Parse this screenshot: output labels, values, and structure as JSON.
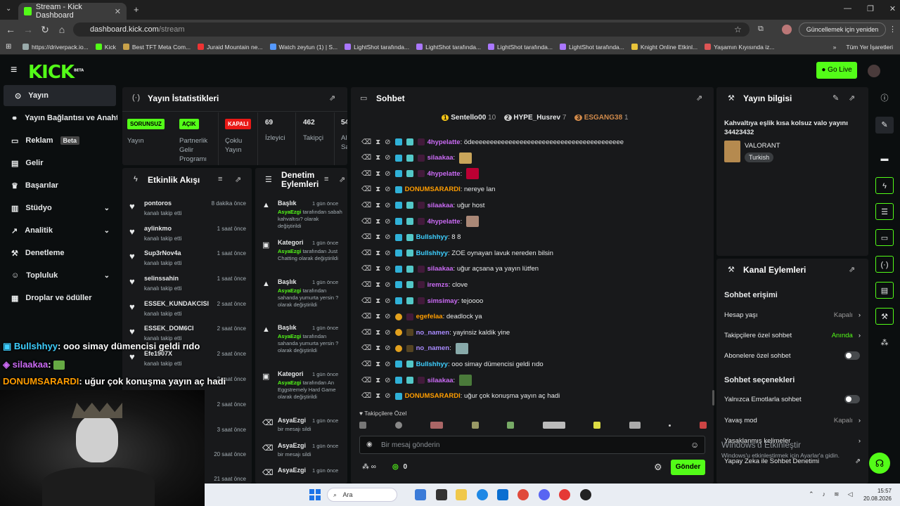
{
  "browser": {
    "tab_title": "Stream - Kick Dashboard",
    "url_host": "dashboard.kick.com",
    "url_path": "/stream",
    "update_button": "Güncellemek için yeniden başlat",
    "bookmarks": [
      "https://driverpack.io...",
      "Kick",
      "Best TFT Meta Com...",
      "Juraid Mountain ne...",
      "Watch zeytun (1) | S...",
      "LightShot tarafında...",
      "LightShot tarafında...",
      "LightShot tarafında...",
      "LightShot tarafında...",
      "Knight Online Etkinl...",
      "Yaşamın Kıyısında iz..."
    ],
    "bookmarks_all": "Tüm Yer İşaretleri"
  },
  "header": {
    "logo": "KICK",
    "logo_sup": "BETA",
    "go_live": "Go Live"
  },
  "sidebar": {
    "items": [
      {
        "label": "Yayın"
      },
      {
        "label": "Yayın Bağlantısı ve Anahtarı"
      },
      {
        "label": "Reklam",
        "badge": "Beta"
      },
      {
        "label": "Gelir"
      },
      {
        "label": "Başarılar"
      },
      {
        "label": "Stüdyo"
      },
      {
        "label": "Analitik"
      },
      {
        "label": "Denetleme"
      },
      {
        "label": "Topluluk"
      },
      {
        "label": "Droplar ve ödüller"
      }
    ]
  },
  "stats": {
    "title": "Yayın İstatistikleri",
    "cols": [
      {
        "tag": "SORUNSUZ",
        "label": "Yayın"
      },
      {
        "tag": "AÇIK",
        "label": "Partnerlik Gelir Programı"
      },
      {
        "tag": "KAPALI",
        "label": "Çoklu Yayın"
      },
      {
        "value": "69",
        "label": "İzleyici"
      },
      {
        "value": "462",
        "label": "Takipçi"
      },
      {
        "value": "54",
        "label": "Al Sa"
      }
    ]
  },
  "activity": {
    "title": "Etkinlik Akışı",
    "items": [
      {
        "name": "pontoros",
        "action": "kanalı takip etti",
        "time": "8 dakika önce"
      },
      {
        "name": "aylinkmo",
        "action": "kanalı takip etti",
        "time": "1 saat önce"
      },
      {
        "name": "Sup3rNov4a",
        "action": "kanalı takip etti",
        "time": "1 saat önce"
      },
      {
        "name": "selinssahin",
        "action": "kanalı takip etti",
        "time": "1 saat önce"
      },
      {
        "name": "ESSEK_KUNDAKCISI",
        "action": "kanalı takip etti",
        "time": "2 saat önce"
      },
      {
        "name": "ESSEK_DOM6CI",
        "action": "kanalı takip etti",
        "time": "2 saat önce"
      },
      {
        "name": "Efe1907X",
        "action": "kanalı takip etti",
        "time": "2 saat önce"
      }
    ],
    "extra_times": [
      "2 saat önce",
      "2 saat önce",
      "3 saat önce",
      "20 saat önce",
      "21 saat önce"
    ]
  },
  "moderation": {
    "title": "Denetim Eylemleri",
    "items": [
      {
        "kind": "Başlık",
        "time": "1 gün önce",
        "user": "AsyaEzgi",
        "text": " tarafından sabah kahvaltısı? olarak değiştirildi"
      },
      {
        "kind": "Kategori",
        "time": "1 gün önce",
        "user": "AsyaEzgi",
        "text": " tarafından Just Chatting olarak değiştirildi"
      },
      {
        "kind": "Başlık",
        "time": "1 gün önce",
        "user": "AsyaEzgi",
        "text": " tarafından sahanda yumurta yersin ? olarak değiştirildi"
      },
      {
        "kind": "Başlık",
        "time": "1 gün önce",
        "user": "AsyaEzgi",
        "text": " tarafından sahanda yumurta yersin ? olarak değiştirildi"
      },
      {
        "kind": "Kategori",
        "time": "1 gün önce",
        "user": "AsyaEzgi",
        "text": " tarafından An Eggstremely Hard Game olarak değiştirildi"
      },
      {
        "kind": "AsyaEzgi",
        "time": "1 gün önce",
        "user": "",
        "text": "bir mesajı sildi"
      },
      {
        "kind": "AsyaEzgi",
        "time": "1 gün önce",
        "user": "",
        "text": "bir mesajı sildi"
      },
      {
        "kind": "AsyaEzgi",
        "time": "1 gün önce",
        "user": "",
        "text": ""
      }
    ]
  },
  "chat": {
    "title": "Sohbet",
    "top": [
      {
        "rank": "1",
        "name": "Sentello00",
        "count": "10"
      },
      {
        "rank": "2",
        "name": "HYPE_Husrev",
        "count": "7"
      },
      {
        "rank": "3",
        "name": "ESGANG38",
        "count": "1"
      }
    ],
    "messages": [
      {
        "user": "4hypelatte",
        "text": "ödeeeeeeeeeeeeeeeeeeeeeeeeeeeeeeeeeeeeeeeee",
        "color": "#cb6bf5"
      },
      {
        "user": "silaakaa",
        "text": "",
        "color": "#cb6bf5"
      },
      {
        "user": "4hypelatte",
        "text": "",
        "color": "#cb6bf5"
      },
      {
        "user": "DONUMSARARDI",
        "text": "nereye lan",
        "color": "#ff9d00"
      },
      {
        "user": "silaakaa",
        "text": "uğur host",
        "color": "#cb6bf5"
      },
      {
        "user": "4hypelatte",
        "text": "",
        "color": "#cb6bf5"
      },
      {
        "user": "Bullshhyy",
        "text": "8 8",
        "color": "#3ecfff"
      },
      {
        "user": "Bullshhyy",
        "text": "ZOE oynayan lavuk nereden bilsin",
        "color": "#3ecfff"
      },
      {
        "user": "silaakaa",
        "text": "uğur açsana ya yayın lütfen",
        "color": "#cb6bf5"
      },
      {
        "user": "iremzs",
        "text": "clove",
        "color": "#cb6bf5"
      },
      {
        "user": "simsimay",
        "text": "tejoooo",
        "color": "#cb6bf5"
      },
      {
        "user": "egefelaa",
        "text": "deadlock ya",
        "color": "#ff9d00"
      },
      {
        "user": "no_namen",
        "text": "yayinsiz kaldik yine",
        "color": "#a98bff"
      },
      {
        "user": "no_namen",
        "text": "",
        "color": "#a98bff"
      },
      {
        "user": "Bullshhyy",
        "text": "ooo simay dümencisi geldi rıdo",
        "color": "#3ecfff"
      },
      {
        "user": "silaakaa",
        "text": "",
        "color": "#cb6bf5"
      },
      {
        "user": "DONUMSARARDI",
        "text": "uğur çok konuşma yayın aç hadi",
        "color": "#ff9d00"
      }
    ],
    "emote_label": "Takipçilere Özel",
    "input_placeholder": "Bir mesaj gönderin",
    "points": "0",
    "send": "Gönder"
  },
  "stream_info": {
    "title": "Yayın bilgisi",
    "stream_title": "Kahvaltıya eşlik kısa kolsuz valo yayını 34423432",
    "game": "VALORANT",
    "language": "Turkish"
  },
  "channel_actions": {
    "title": "Kanal Eylemleri",
    "section1": "Sohbet erişimi",
    "account_age": "Hesap yaşı",
    "account_age_val": "Kapalı",
    "followers_only": "Takipçilere özel sohbet",
    "followers_only_val": "Anında",
    "subs_only": "Abonelere özel sohbet",
    "section2": "Sohbet seçenekleri",
    "emote_only": "Yalnızca Emotlarla sohbet",
    "slow_mode": "Yavaş mod",
    "slow_mode_val": "Kapalı",
    "banned_words": "Yasaklanmış kelimeler",
    "ai_mod": "Yapay Zeka ile Sohbet Denetimi"
  },
  "overlay": {
    "lines": [
      {
        "user": "Bullshhyy",
        "text": ": ooo simay dümencisi geldi rıdo",
        "color": "#3ecfff"
      },
      {
        "user": "silaakaa",
        "text": ":",
        "color": "#cb6bf5"
      },
      {
        "user": "DONUMSARARDI",
        "text": ": uğur çok konuşma yayın aç hadi",
        "color": "#ff9d00"
      }
    ]
  },
  "windows": {
    "activate1": "Windows'u Etkinleştir",
    "activate2": "Windows'u etkinleştirmek için Ayarlar'a gidin.",
    "search": "Ara",
    "time": "15:57",
    "date": "20.08.2026"
  }
}
